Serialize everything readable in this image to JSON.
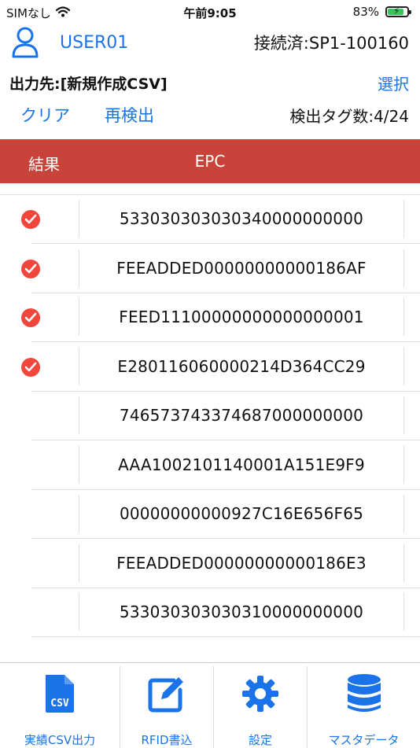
{
  "status_bar": {
    "carrier": "SIMなし",
    "time": "午前9:05",
    "battery": "83%",
    "battery_level": 0.83
  },
  "header": {
    "user": "USER01",
    "connection": "接続済:SP1-100160"
  },
  "output": {
    "label": "出力先:[新規作成CSV]",
    "select": "選択"
  },
  "actions": {
    "clear": "クリア",
    "redetect": "再検出",
    "count": "検出タグ数:4/24"
  },
  "table": {
    "columns": [
      "結果",
      "EPC"
    ],
    "rows": [
      {
        "epc": "533030303030340000000000",
        "checked": true
      },
      {
        "epc": "FEEADDED00000000000186AF",
        "checked": true
      },
      {
        "epc": "FEED11100000000000000001",
        "checked": true
      },
      {
        "epc": "E280116060000214D364CC29",
        "checked": true
      },
      {
        "epc": "746573743374687000000000",
        "checked": false
      },
      {
        "epc": "AAA1002101140001A151E9F9",
        "checked": false
      },
      {
        "epc": "00000000000927C16E656F65",
        "checked": false
      },
      {
        "epc": "FEEADDED00000000000186E3",
        "checked": false
      },
      {
        "epc": "533030303030310000000000",
        "checked": false
      }
    ]
  },
  "tabs": [
    {
      "label": "実績CSV出力",
      "icon": "csv-file-icon"
    },
    {
      "label": "RFID書込",
      "icon": "edit-icon"
    },
    {
      "label": "設定",
      "icon": "gear-icon"
    },
    {
      "label": "マスタデータ",
      "icon": "database-icon"
    }
  ],
  "colors": {
    "accent": "#1a73e8",
    "header_bar": "#c8443a",
    "check": "#f0463b"
  }
}
